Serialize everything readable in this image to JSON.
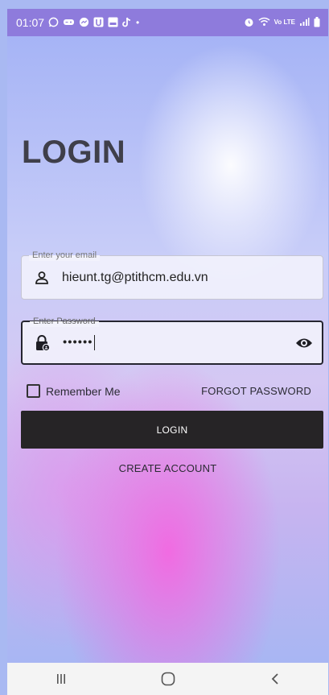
{
  "status_bar": {
    "time": "01:07",
    "network_badge": "Vo LTE",
    "colors": {
      "background": "#8e7bdc"
    }
  },
  "login": {
    "title": "LOGIN",
    "email": {
      "label": "Enter your email",
      "value": "hieunt.tg@ptithcm.edu.vn",
      "icon": "person-icon"
    },
    "password": {
      "label": "Enter Password",
      "value": "••••••",
      "icon": "lock-icon",
      "toggle_icon": "eye-icon"
    },
    "remember_me": {
      "label": "Remember Me",
      "checked": false
    },
    "forgot_password": "FORGOT PASSWORD",
    "login_button": "LOGIN",
    "create_account": "CREATE ACCOUNT",
    "colors": {
      "button": "#262426",
      "title": "#3f3f4a",
      "accent_pink": "#f663e0"
    }
  },
  "nav_bar": {
    "recents_icon": "recents-icon",
    "home_icon": "home-icon",
    "back_icon": "back-icon"
  }
}
